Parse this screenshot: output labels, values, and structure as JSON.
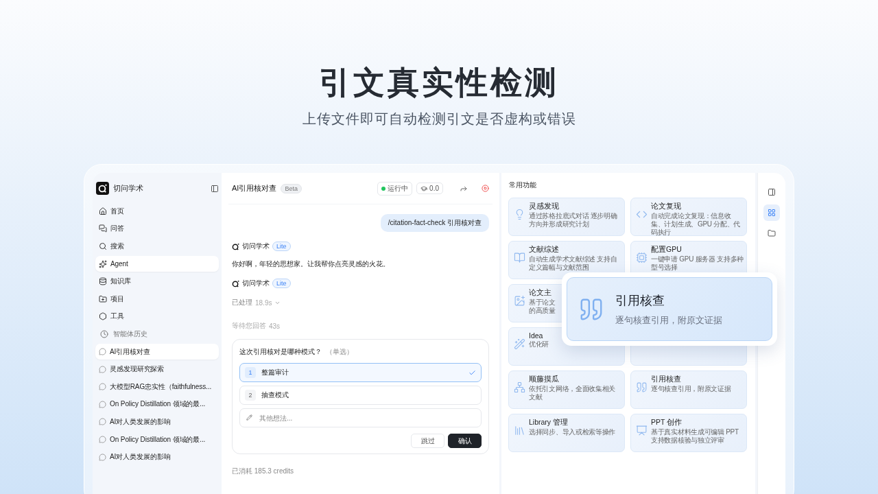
{
  "hero": {
    "title": "引文真实性检测",
    "subtitle": "上传文件即可自动检测引文是否虚构或错误"
  },
  "sidebar": {
    "brand": "切问学术",
    "nav": [
      {
        "label": "首页",
        "selected": false
      },
      {
        "label": "问答",
        "selected": false
      },
      {
        "label": "搜索",
        "selected": false
      },
      {
        "label": "Agent",
        "selected": true
      },
      {
        "label": "知识库",
        "selected": false
      },
      {
        "label": "项目",
        "selected": false
      },
      {
        "label": "工具",
        "selected": false
      }
    ],
    "history_heading": "智能体历史",
    "history": [
      {
        "label": "AI引用核对查",
        "selected": true
      },
      {
        "label": "灵感发现研究探索",
        "selected": false
      },
      {
        "label": "大模型RAG忠实性（faithfulness...",
        "selected": false
      },
      {
        "label": "On Policy Distillation 领域的最...",
        "selected": false
      },
      {
        "label": "AI对人类发展的影响",
        "selected": false
      },
      {
        "label": "On Policy Distillation 领域的最...",
        "selected": false
      },
      {
        "label": "AI对人类发展的影响",
        "selected": false
      }
    ]
  },
  "chat": {
    "title": "AI引用核对查",
    "badge": "Beta",
    "status": "运行中",
    "score": "0.0",
    "user_message": "/citation-fact-check 引用核对查",
    "messages": [
      {
        "sender": "切问学术",
        "tag": "Lite",
        "text": "你好啊，年轻的思想家。让我帮你点亮灵感的火花。"
      },
      {
        "sender": "切问学术",
        "tag": "Lite"
      }
    ],
    "processed": "已处理",
    "processed_time": "18.9s",
    "waiting": "等待您回答",
    "waiting_time": "43s",
    "question": {
      "title": "这次引用核对是哪种模式？",
      "hint": "（单选）",
      "options": [
        {
          "number": "1",
          "label": "整篇审计",
          "selected": true
        },
        {
          "number": "2",
          "label": "抽查模式",
          "selected": false
        }
      ],
      "placeholder": "其他想法...",
      "skip": "跳过",
      "confirm": "确认"
    },
    "credits": "已消耗 185.3 credits"
  },
  "features": {
    "heading": "常用功能",
    "left": [
      {
        "kind": "feature",
        "title": "灵感发现",
        "desc": "通过苏格拉底式对话 逐步明确方向并形成研究计划"
      },
      {
        "kind": "feature",
        "title": "文献综述",
        "desc": "自动生成学术文献综述 支持自定义篇幅与文献范围"
      },
      {
        "kind": "partial",
        "title": "论文主",
        "desc": "基于论文的高质量"
      },
      {
        "kind": "partial",
        "title": "Idea",
        "desc": "优化研"
      },
      {
        "kind": "feature",
        "title": "顺藤摸瓜",
        "desc": "依托引文网络，全面收集相关文献"
      },
      {
        "kind": "feature",
        "title": "Library 管理",
        "desc": "选择同步、导入或检索等操作"
      }
    ],
    "right": [
      {
        "kind": "feature",
        "title": "论文复现",
        "desc": "自动完成论文复现：信息收集、计划生成、GPU 分配、代码执行"
      },
      {
        "kind": "feature",
        "title": "配置GPU",
        "desc": "一键申请 GPU 服务器 支持多种型号选择"
      },
      {
        "kind": "covered"
      },
      {
        "kind": "covered"
      },
      {
        "kind": "feature",
        "title": "引用核查",
        "desc": "逐句核查引用，附原文证据"
      },
      {
        "kind": "feature",
        "title": "PPT 创作",
        "desc": "基于真实材料生成可编辑 PPT 支持数据核验与独立评审"
      }
    ],
    "highlight": {
      "title": "引用核查",
      "desc": "逐句核查引用，附原文证据"
    }
  },
  "rail": [
    {
      "selected": false
    },
    {
      "selected": true
    },
    {
      "selected": false
    }
  ]
}
